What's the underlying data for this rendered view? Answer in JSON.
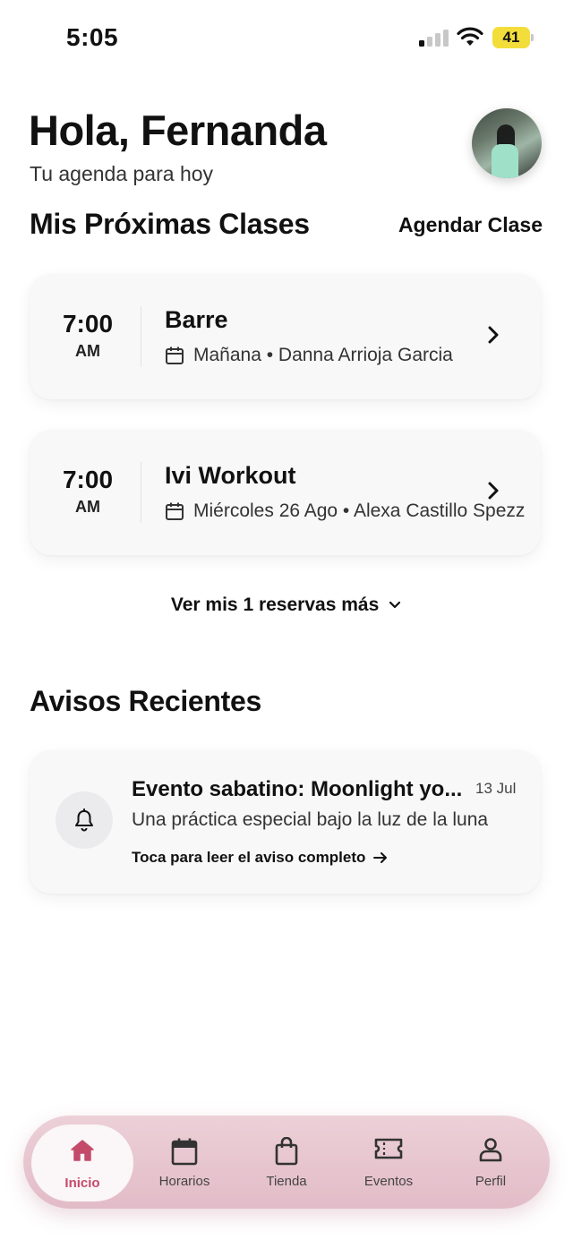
{
  "status_bar": {
    "time": "5:05",
    "battery": "41"
  },
  "header": {
    "greeting": "Hola, Fernanda",
    "subtitle": "Tu agenda para hoy"
  },
  "upcoming": {
    "title": "Mis Próximas Clases",
    "action": "Agendar Clase",
    "classes": [
      {
        "time": "7:00",
        "ampm": "AM",
        "name": "Barre",
        "meta": "Mañana • Danna Arrioja Garcia"
      },
      {
        "time": "7:00",
        "ampm": "AM",
        "name": "Ivi Workout",
        "meta": "Miércoles 26 Ago • Alexa Castillo Spezz"
      }
    ],
    "more_link": "Ver mis 1 reservas más"
  },
  "notices": {
    "title": "Avisos Recientes",
    "items": [
      {
        "title": "Evento sabatino: Moonlight yo...",
        "date": "13 Jul",
        "body": "Una práctica especial bajo la luz de la luna",
        "link": "Toca para leer el aviso completo"
      }
    ]
  },
  "bottom_nav": {
    "accent": "#c44a6a",
    "items": [
      {
        "label": "Inicio",
        "icon": "home-icon",
        "active": true
      },
      {
        "label": "Horarios",
        "icon": "calendar-icon",
        "active": false
      },
      {
        "label": "Tienda",
        "icon": "shopping-bag-icon",
        "active": false
      },
      {
        "label": "Eventos",
        "icon": "ticket-icon",
        "active": false
      },
      {
        "label": "Perfil",
        "icon": "user-icon",
        "active": false
      }
    ]
  }
}
